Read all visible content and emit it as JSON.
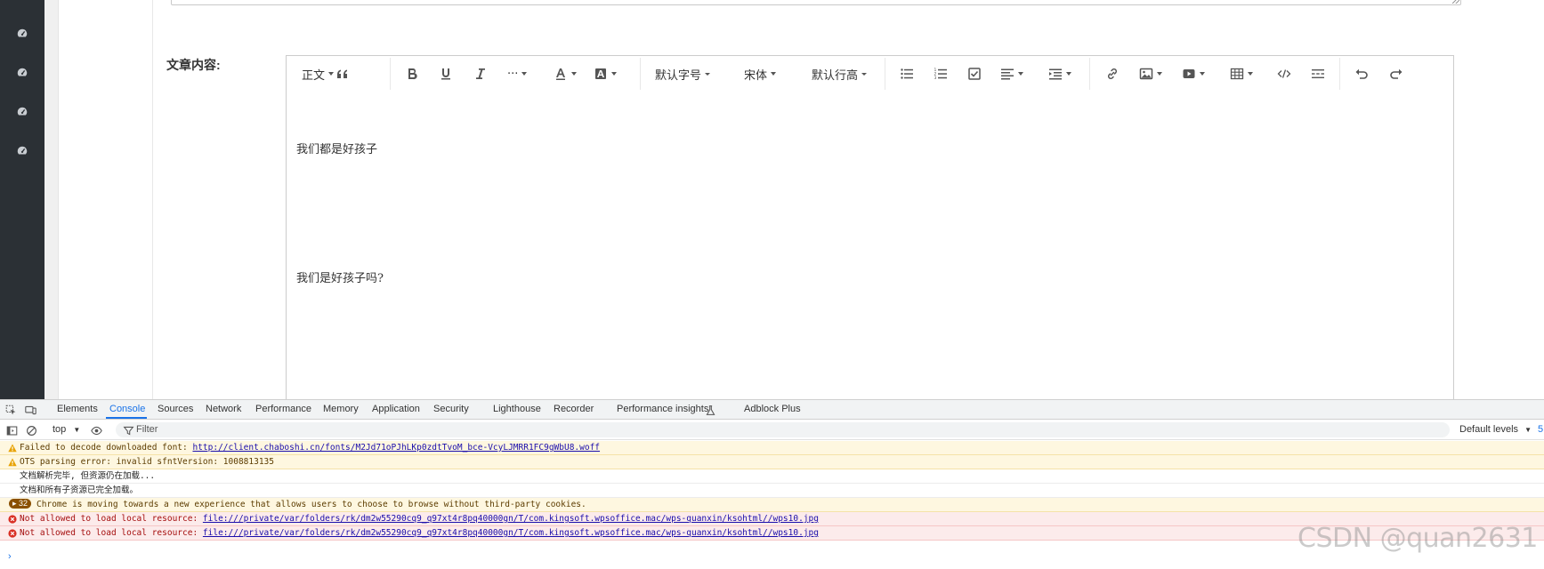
{
  "page": {
    "article_label": "文章内容:",
    "sidebar_icons": [
      "dashboard-icon",
      "dashboard-icon",
      "dashboard-icon",
      "dashboard-icon"
    ]
  },
  "editor": {
    "toolbar": {
      "paragraph_style": "正文",
      "font_size": "默认字号",
      "font_family": "宋体",
      "line_height": "默认行高",
      "more": "···"
    },
    "paragraphs": [
      "我们都是好孩子",
      "我们是好孩子吗?"
    ]
  },
  "devtools": {
    "tabs": [
      "Elements",
      "Console",
      "Sources",
      "Network",
      "Performance",
      "Memory",
      "Application",
      "Security",
      "Lighthouse",
      "Recorder",
      "Performance insights",
      "Adblock Plus"
    ],
    "active_tab": "Console",
    "context": "top",
    "filter_placeholder": "Filter",
    "levels": "Default levels",
    "issues_count": "5",
    "messages": [
      {
        "level": "warn",
        "text": "Failed to decode downloaded font: ",
        "link": "http://client.chaboshi.cn/fonts/M2Jd71oPJhLKp0zdtTvoM_bce-VcyLJMRR1FC9gWbU8.woff"
      },
      {
        "level": "warn",
        "text": "OTS parsing error: invalid sfntVersion: 1008813135",
        "link": ""
      },
      {
        "level": "info",
        "text": "文档解析完毕, 但资源仍在加载...",
        "link": ""
      },
      {
        "level": "info",
        "text": "文档和所有子资源已完全加载。",
        "link": ""
      },
      {
        "level": "warn",
        "badge": "32",
        "text": "Chrome is moving towards a new experience that allows users to choose to browse without third-party cookies.",
        "link": ""
      },
      {
        "level": "err",
        "text": "Not allowed to load local resource: ",
        "link": "file:///private/var/folders/rk/dm2w55290cq9_q97xt4r8pq40000gn/T/com.kingsoft.wpsoffice.mac/wps-quanxin/ksohtml//wps10.jpg"
      },
      {
        "level": "err",
        "text": "Not allowed to load local resource: ",
        "link": "file:///private/var/folders/rk/dm2w55290cq9_q97xt4r8pq40000gn/T/com.kingsoft.wpsoffice.mac/wps-quanxin/ksohtml//wps10.jpg"
      }
    ]
  },
  "watermark": "CSDN @quan2631",
  "colors": {
    "sidebar": "#2b3035",
    "accent": "#1a73e8",
    "warn_bg": "#fef7e0",
    "error_bg": "#fcebeb"
  }
}
